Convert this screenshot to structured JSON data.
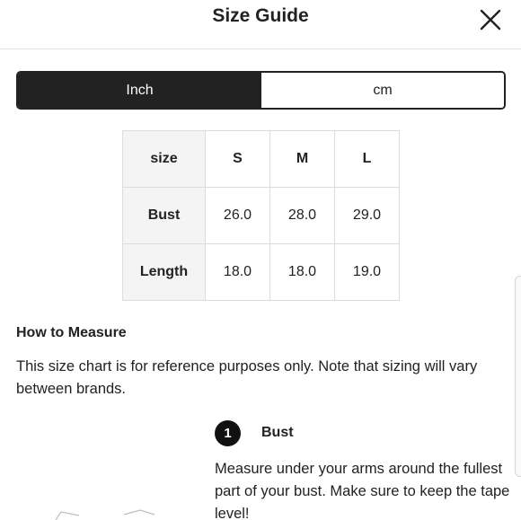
{
  "header": {
    "title": "Size Guide"
  },
  "units": {
    "options": [
      "Inch",
      "cm"
    ],
    "selected": "Inch"
  },
  "size_table": {
    "header": [
      "size",
      "S",
      "M",
      "L"
    ],
    "rows": [
      {
        "label": "Bust",
        "values": [
          "26.0",
          "28.0",
          "29.0"
        ]
      },
      {
        "label": "Length",
        "values": [
          "18.0",
          "18.0",
          "19.0"
        ]
      }
    ]
  },
  "how_to_measure": {
    "title": "How to Measure",
    "note": "This size chart is for reference purposes only. Note that sizing will vary between brands.",
    "steps": [
      {
        "number": "1",
        "label": "Bust",
        "text": "Measure under your arms around the fullest part of your bust. Make sure to keep the tape level!"
      }
    ]
  },
  "colors": {
    "accent": "#222222",
    "border": "#dcdcdc",
    "header_cell_bg": "#f4f4f4"
  },
  "icons": {
    "close": "close-icon"
  }
}
